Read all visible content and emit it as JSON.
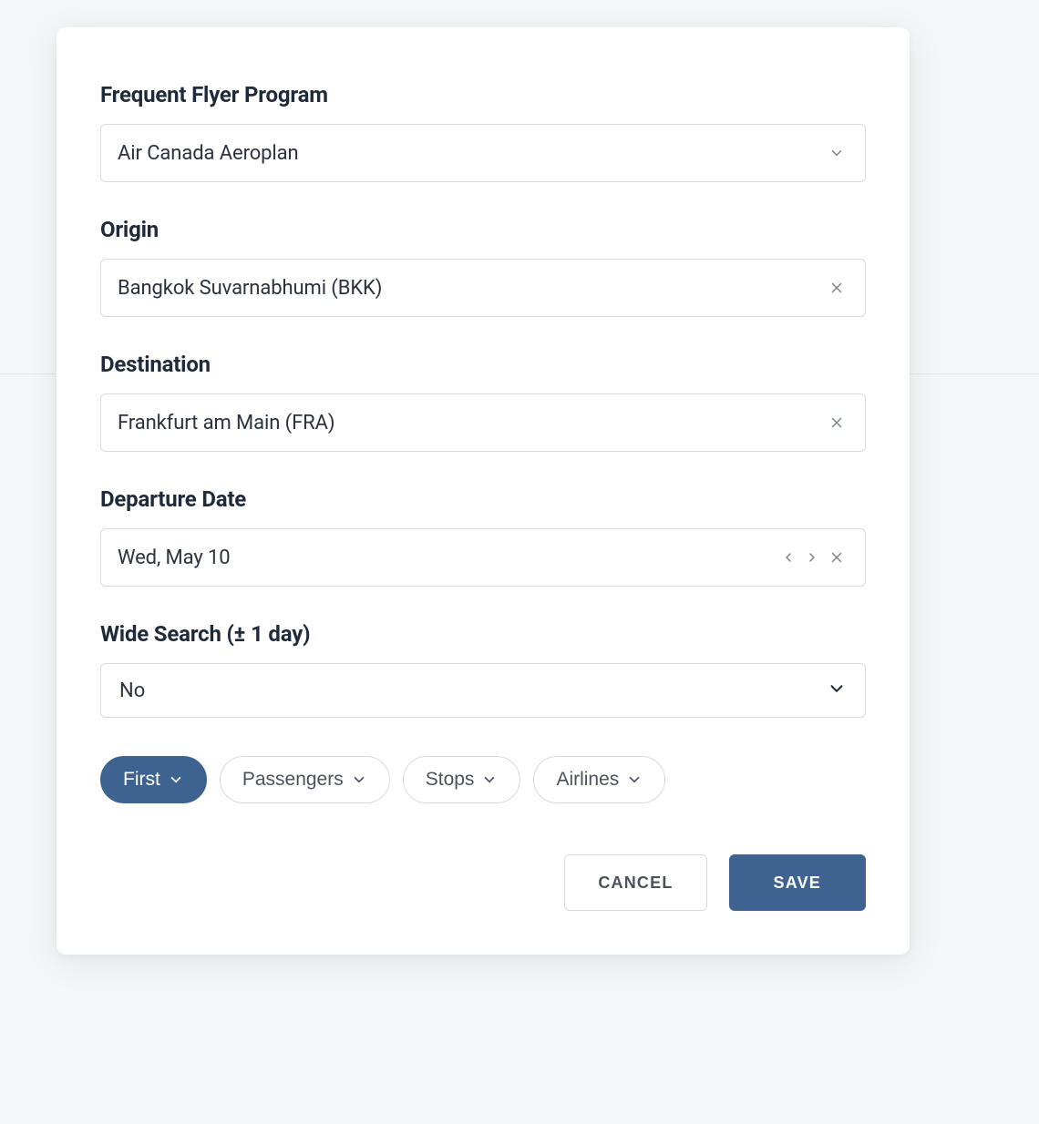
{
  "fields": {
    "program": {
      "label": "Frequent Flyer Program",
      "value": "Air Canada Aeroplan"
    },
    "origin": {
      "label": "Origin",
      "value": "Bangkok Suvarnabhumi (BKK)"
    },
    "destination": {
      "label": "Destination",
      "value": "Frankfurt am Main (FRA)"
    },
    "departure": {
      "label": "Departure Date",
      "value": "Wed, May 10"
    },
    "wide_search": {
      "label": "Wide Search (± 1 day)",
      "value": "No"
    }
  },
  "chips": {
    "cabin": "First",
    "passengers": "Passengers",
    "stops": "Stops",
    "airlines": "Airlines"
  },
  "footer": {
    "cancel": "CANCEL",
    "save": "SAVE"
  },
  "colors": {
    "accent": "#3f6390",
    "border": "#d7dbe0",
    "text": "#2b3340",
    "muted": "#7b828c"
  }
}
